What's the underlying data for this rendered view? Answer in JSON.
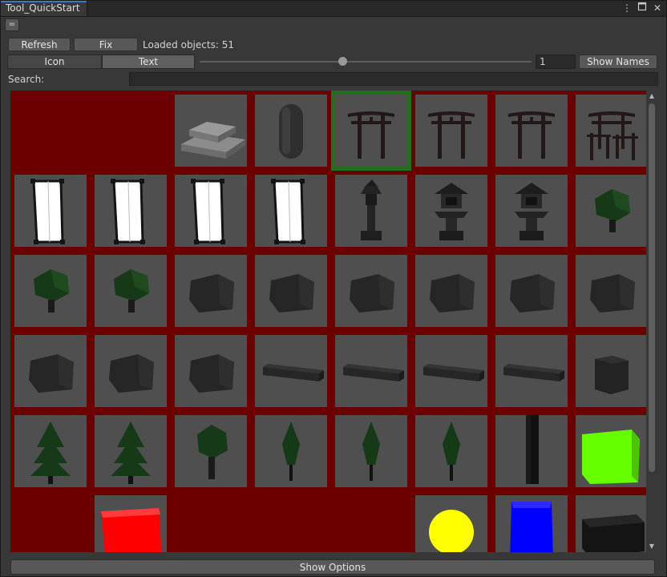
{
  "window": {
    "tab_title": "Tool_QuickStart",
    "icons": [
      "more-vert-icon",
      "maximize-icon",
      "close-icon"
    ]
  },
  "toolbar": {
    "menu_glyph": "=",
    "refresh_label": "Refresh",
    "fix_label": "Fix",
    "loaded_text": "Loaded objects: 51"
  },
  "view_mode": {
    "icon_label": "Icon",
    "text_label": "Text",
    "selected": "Text"
  },
  "size": {
    "slider_level": 0.43,
    "value": "1"
  },
  "show_names_label": "Show Names",
  "search": {
    "label": "Search:",
    "value": ""
  },
  "grid": {
    "selected_index": 4,
    "items": [
      "empty",
      "empty",
      "stone-steps",
      "capsule",
      "torii-gate",
      "torii-gate",
      "torii-gate",
      "torii-fence",
      "paper-lantern",
      "paper-lantern",
      "paper-lantern",
      "paper-lantern",
      "stone-lantern-tall",
      "stone-lantern",
      "stone-lantern",
      "bush",
      "bush",
      "bush",
      "rock",
      "rock",
      "rock",
      "rock",
      "rock",
      "rock",
      "rock",
      "rock",
      "rock",
      "log",
      "log",
      "log",
      "log",
      "stump",
      "pine-tree",
      "pine-tree",
      "round-tree",
      "cypress-tree",
      "cypress-tree",
      "cypress-tree",
      "tall-pillar",
      "green-cube",
      "empty",
      "red-cube",
      "empty",
      "empty",
      "empty",
      "yellow-sphere",
      "blue-cube",
      "dark-box"
    ]
  },
  "colors": {
    "selection": "#1f6f1c",
    "tile_border": "#6c0000",
    "tab_accent": "#3a79bb"
  },
  "show_options_label": "Show Options"
}
